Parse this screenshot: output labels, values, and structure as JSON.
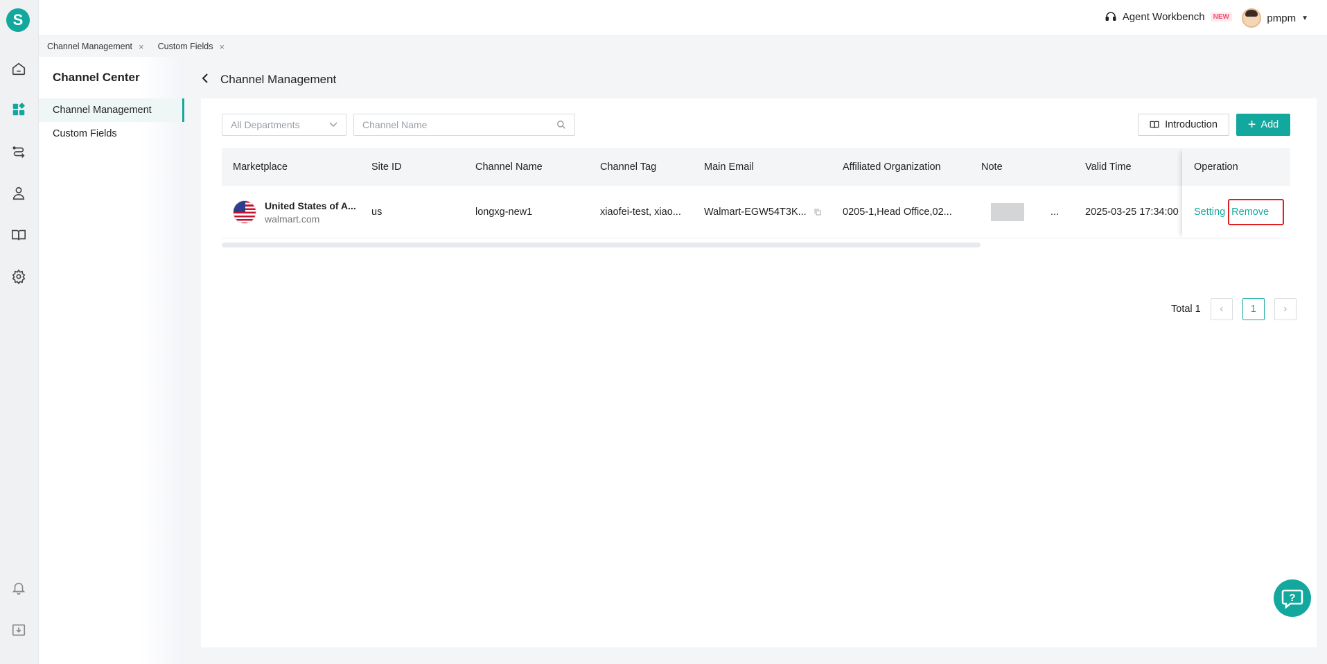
{
  "app": {
    "logo_letter": "S"
  },
  "topbar": {
    "agent_label": "Agent Workbench",
    "agent_badge": "NEW",
    "user_name": "pmpm"
  },
  "tabs": [
    {
      "label": "Channel Management"
    },
    {
      "label": "Custom Fields"
    }
  ],
  "sidebar": {
    "title": "Channel Center",
    "items": [
      {
        "label": "Channel Management"
      },
      {
        "label": "Custom Fields"
      }
    ]
  },
  "page": {
    "title": "Channel Management"
  },
  "filters": {
    "department_value": "All Departments",
    "channel_name_placeholder": "Channel Name"
  },
  "toolbar": {
    "intro_label": "Introduction",
    "add_label": "Add"
  },
  "table": {
    "headers": {
      "marketplace": "Marketplace",
      "site_id": "Site ID",
      "channel_name": "Channel Name",
      "channel_tag": "Channel Tag",
      "main_email": "Main Email",
      "affiliated_org": "Affiliated Organization",
      "note": "Note",
      "valid_time": "Valid Time",
      "operation": "Operation"
    },
    "rows": [
      {
        "marketplace_name": "United States of A...",
        "marketplace_domain": "walmart.com",
        "site_id": "us",
        "channel_name": "longxg-new1",
        "channel_tag": "xiaofei-test, xiao...",
        "main_email": "Walmart-EGW54T3K...",
        "affiliated_org": "0205-1,Head Office,02...",
        "note_more": "...",
        "valid_time": "2025-03-25 17:34:00",
        "setting_label": "Setting",
        "remove_label": "Remove"
      }
    ]
  },
  "pagination": {
    "total_label": "Total 1",
    "current_page": "1"
  },
  "colors": {
    "accent": "#13a89e",
    "highlight": "#e02020"
  }
}
